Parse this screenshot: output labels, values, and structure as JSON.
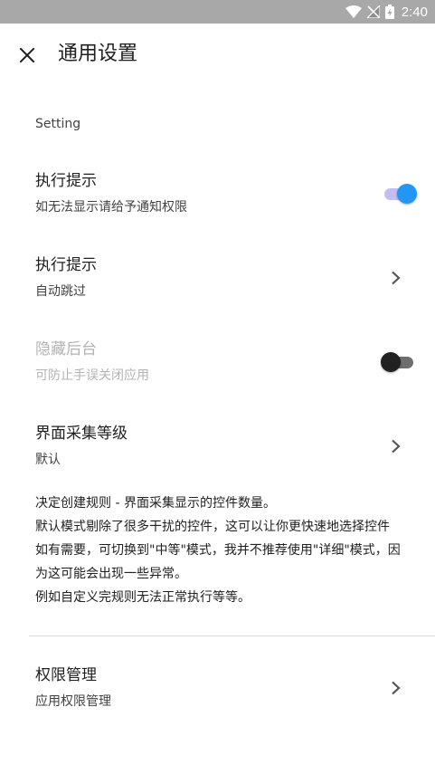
{
  "status_bar": {
    "time": "2:40"
  },
  "header": {
    "title": "通用设置"
  },
  "section": {
    "label": "Setting"
  },
  "items": [
    {
      "title": "执行提示",
      "subtitle": "如无法显示请给予通知权限",
      "control": "switch",
      "checked": true
    },
    {
      "title": "执行提示",
      "subtitle": "自动跳过",
      "control": "chevron"
    },
    {
      "title": "隐藏后台",
      "subtitle": "可防止手误关闭应用",
      "control": "switch",
      "checked": false,
      "disabled": true
    },
    {
      "title": "界面采集等级",
      "subtitle": "默认",
      "control": "chevron"
    }
  ],
  "description": {
    "lines": [
      "决定创建规则 - 界面采集显示的控件数量。",
      "默认模式剔除了很多干扰的控件，这可以让你更快速地选择控件",
      "如有需要，可切换到\"中等\"模式，我并不推荐使用\"详细\"模式，因",
      "为这可能会出现一些异常。",
      "例如自定义完规则无法正常执行等等。"
    ]
  },
  "permissions": {
    "title": "权限管理",
    "subtitle": "应用权限管理"
  },
  "colors": {
    "accent": "#2196f3",
    "switch_track_on": "#c4bdf3",
    "status_bar": "#a8a8a8"
  }
}
